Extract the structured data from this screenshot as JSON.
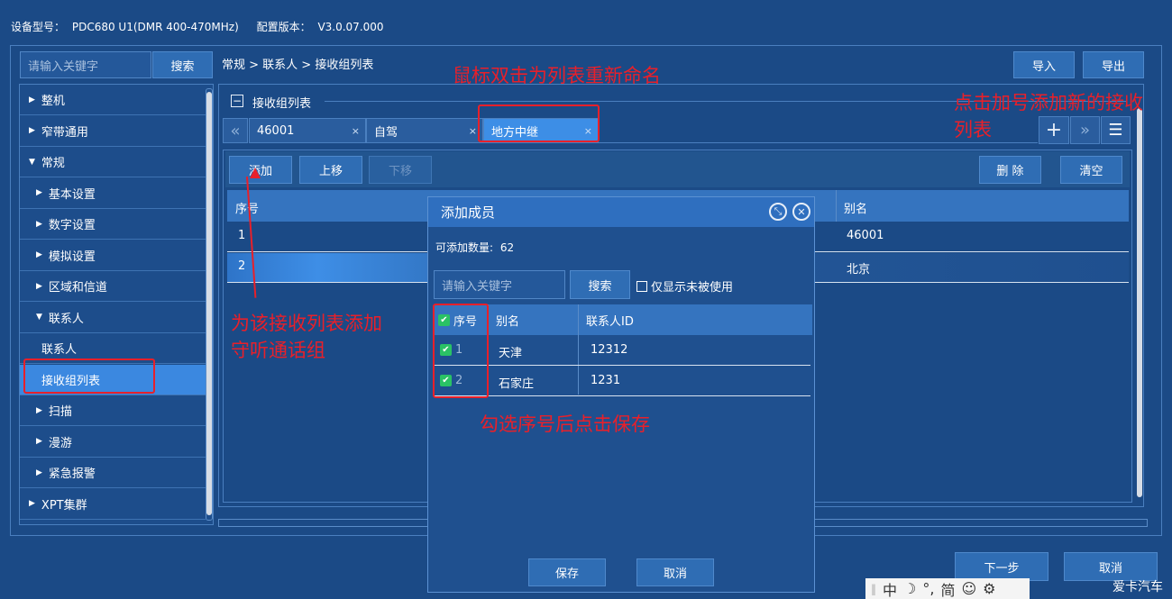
{
  "device": {
    "model_label": "设备型号：",
    "model_value": "PDC680 U1(DMR 400-470MHz)",
    "config_label": "配置版本：",
    "config_value": "V3.0.07.000"
  },
  "search": {
    "placeholder": "请输入关键字",
    "button": "搜索"
  },
  "breadcrumb": "常规 > 联系人 > 接收组列表",
  "top_buttons": {
    "import": "导入",
    "export": "导出"
  },
  "sidebar": {
    "items": [
      {
        "label": "整机",
        "level": 0,
        "expanded": false
      },
      {
        "label": "窄带通用",
        "level": 0,
        "expanded": false
      },
      {
        "label": "常规",
        "level": 0,
        "expanded": true
      },
      {
        "label": "基本设置",
        "level": 1,
        "expanded": false
      },
      {
        "label": "数字设置",
        "level": 1,
        "expanded": false
      },
      {
        "label": "模拟设置",
        "level": 1,
        "expanded": false
      },
      {
        "label": "区域和信道",
        "level": 1,
        "expanded": false
      },
      {
        "label": "联系人",
        "level": 1,
        "expanded": true
      },
      {
        "label": "联系人",
        "level": 2
      },
      {
        "label": "接收组列表",
        "level": 2,
        "active": true
      },
      {
        "label": "扫描",
        "level": 1,
        "expanded": false
      },
      {
        "label": "漫游",
        "level": 1,
        "expanded": false
      },
      {
        "label": "紧急报警",
        "level": 1,
        "expanded": false
      },
      {
        "label": "XPT集群",
        "level": 0,
        "expanded": false
      }
    ]
  },
  "panel": {
    "title": "接收组列表",
    "collapse_icon": "minus-box-icon",
    "tabs": [
      {
        "label": "46001"
      },
      {
        "label": "自驾"
      },
      {
        "label": "地方中继",
        "active": true
      }
    ],
    "close_glyph": "×",
    "tab_tools": {
      "prev_icon": "double-chevron-left-icon",
      "add_icon": "plus-icon",
      "next_icon": "double-chevron-right-icon",
      "menu_icon": "menu-icon"
    },
    "toolbar": {
      "add": "添加",
      "up": "上移",
      "down": "下移",
      "delete": "删 除",
      "clear": "清空"
    },
    "table": {
      "headers": {
        "index": "序号",
        "alias": "别名"
      },
      "rows": [
        {
          "index": "1",
          "alias": "46001"
        },
        {
          "index": "2",
          "alias": "北京"
        }
      ]
    }
  },
  "dialog": {
    "title": "添加成员",
    "count_label": "可添加数量:",
    "count_value": "62",
    "search_placeholder": "请输入关键字",
    "search_button": "搜索",
    "only_unused": "仅显示未被使用",
    "headers": {
      "index": "序号",
      "alias": "别名",
      "contact_id": "联系人ID"
    },
    "rows": [
      {
        "index": "1",
        "alias": "天津",
        "contact_id": "12312",
        "checked": true
      },
      {
        "index": "2",
        "alias": "石家庄",
        "contact_id": "1231",
        "checked": true
      }
    ],
    "save": "保存",
    "cancel": "取消"
  },
  "footer": {
    "next": "下一步",
    "cancel": "取消"
  },
  "ime": {
    "chars": [
      "中",
      "☽",
      "°,",
      "简",
      "☺",
      "⚙"
    ]
  },
  "watermark": "爱卡汽车",
  "annotations": {
    "rename": "鼠标双击为列表重新命名",
    "add_tab_line1": "点击加号添加新的接收",
    "add_tab_line2": "列表",
    "add_group_line1": "为该接收列表添加",
    "add_group_line2": "守听通话组",
    "check_save": "勾选序号后点击保存"
  },
  "colors": {
    "background": "#1b4a86",
    "accent": "#3b88e0",
    "annotation": "#e8202a",
    "check": "#2ac265"
  }
}
